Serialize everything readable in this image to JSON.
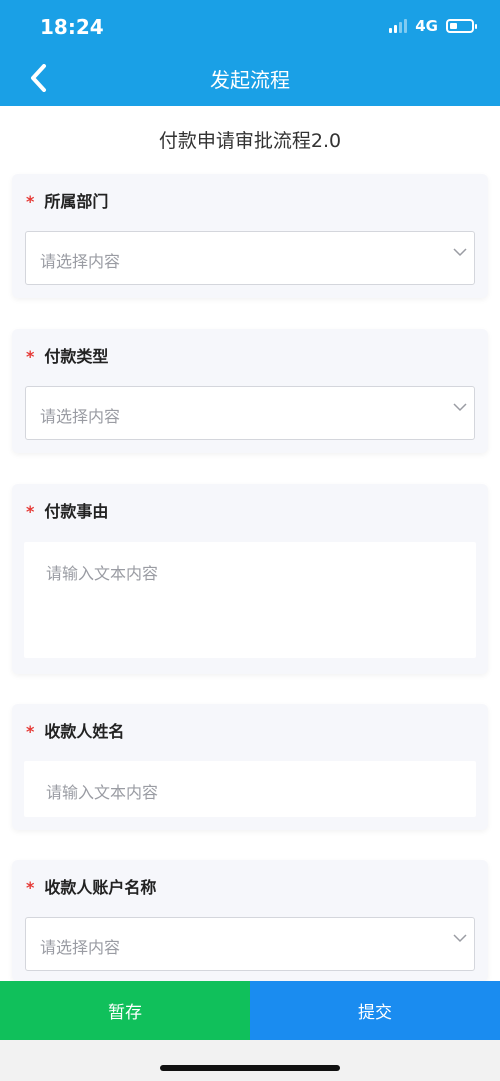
{
  "status_bar": {
    "time": "18:24",
    "network": "4G"
  },
  "nav": {
    "title": "发起流程",
    "back_icon": "chevron-left-icon"
  },
  "form": {
    "title": "付款申请审批流程2.0",
    "required_mark": "*",
    "fields": [
      {
        "label": "所属部门",
        "type": "select",
        "placeholder": "请选择内容"
      },
      {
        "label": "付款类型",
        "type": "select",
        "placeholder": "请选择内容"
      },
      {
        "label": "付款事由",
        "type": "textarea",
        "placeholder": "请输入文本内容"
      },
      {
        "label": "收款人姓名",
        "type": "text",
        "placeholder": "请输入文本内容"
      },
      {
        "label": "收款人账户名称",
        "type": "select",
        "placeholder": "请选择内容"
      }
    ]
  },
  "actions": {
    "save_label": "暂存",
    "submit_label": "提交"
  },
  "colors": {
    "header": "#1aa0e6",
    "save": "#10c05b",
    "submit": "#1a8cf0",
    "required": "#e53935"
  }
}
